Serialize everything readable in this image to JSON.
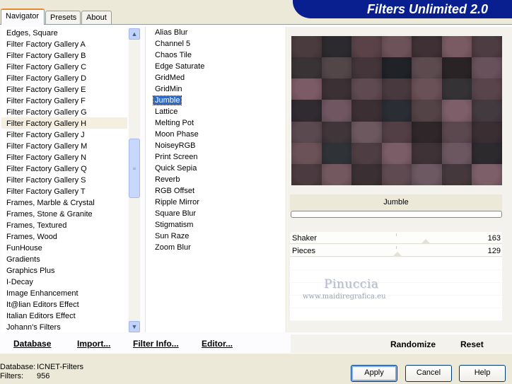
{
  "window": {
    "banner_title": "Filters Unlimited 2.0"
  },
  "tabs": [
    {
      "label": "Navigator",
      "active": true
    },
    {
      "label": "Presets",
      "active": false
    },
    {
      "label": "About",
      "active": false
    }
  ],
  "categories": {
    "selected": "Filter Factory Gallery H",
    "items": [
      "Edges, Square",
      "Filter Factory Gallery A",
      "Filter Factory Gallery B",
      "Filter Factory Gallery C",
      "Filter Factory Gallery D",
      "Filter Factory Gallery E",
      "Filter Factory Gallery F",
      "Filter Factory Gallery G",
      "Filter Factory Gallery H",
      "Filter Factory Gallery J",
      "Filter Factory Gallery M",
      "Filter Factory Gallery N",
      "Filter Factory Gallery Q",
      "Filter Factory Gallery S",
      "Filter Factory Gallery T",
      "Frames, Marble & Crystal",
      "Frames, Stone & Granite",
      "Frames, Textured",
      "Frames, Wood",
      "FunHouse",
      "Gradients",
      "Graphics Plus",
      "I-Decay",
      "Image Enhancement",
      "It@lian Editors Effect",
      "Italian Editors Effect",
      "Johann's Filters"
    ]
  },
  "filters": {
    "selected": "Jumble",
    "items": [
      "Alias Blur",
      "Channel 5",
      "Chaos Tile",
      "Edge Saturate",
      "GridMed",
      "GridMin",
      "Jumble",
      "Lattice",
      "Melting Pot",
      "Moon Phase",
      "NoiseyRGB",
      "Print Screen",
      "Quick Sepia",
      "Reverb",
      "RGB Offset",
      "Ripple Mirror",
      "Square Blur",
      "Stigmatism",
      "Sun Raze",
      "Zoom Blur"
    ]
  },
  "preview": {
    "filter_name": "Jumble",
    "tile_colors": [
      "#4a3b3e",
      "#2c2a2e",
      "#5a4248",
      "#6d5259",
      "#3e3034",
      "#7a5a63",
      "#4d3c42",
      "#3a3336",
      "#524649",
      "#433539",
      "#1f2226",
      "#5c4a4f",
      "#2a2326",
      "#68515a",
      "#7b5b65",
      "#3b3034",
      "#5e4a50",
      "#48393e",
      "#6a5057",
      "#353236",
      "#5a444b",
      "#2f2b30",
      "#6f5660",
      "#3c2f33",
      "#2a2d33",
      "#534246",
      "#7d5e69",
      "#433a3f",
      "#5b4950",
      "#403538",
      "#6d5860",
      "#523f45",
      "#2e2629",
      "#5a484e",
      "#3a2e32",
      "#6a5258",
      "#2f3338",
      "#4e3e43",
      "#7a5d67",
      "#3f3236",
      "#6c5760",
      "#2d2a2e",
      "#4b3a3f",
      "#735860",
      "#3a3034",
      "#5f4a51",
      "#6c5961",
      "#44383c",
      "#7c5f69"
    ]
  },
  "params": [
    {
      "label": "Shaker",
      "value": "163",
      "level": 0.64
    },
    {
      "label": "Pieces",
      "value": "129",
      "level": 0.506
    }
  ],
  "watermark": {
    "name": "Pinuccia",
    "url": "www.maidiregrafica.eu"
  },
  "toolbar": {
    "database": "Database",
    "import": "Import...",
    "filter_info": "Filter Info...",
    "editor": "Editor...",
    "randomize": "Randomize",
    "reset": "Reset"
  },
  "status": {
    "database_label": "Database:",
    "database_value": "ICNET-Filters",
    "filters_label": "Filters:",
    "filters_value": "956"
  },
  "buttons": {
    "apply": "Apply",
    "cancel": "Cancel",
    "help": "Help"
  }
}
